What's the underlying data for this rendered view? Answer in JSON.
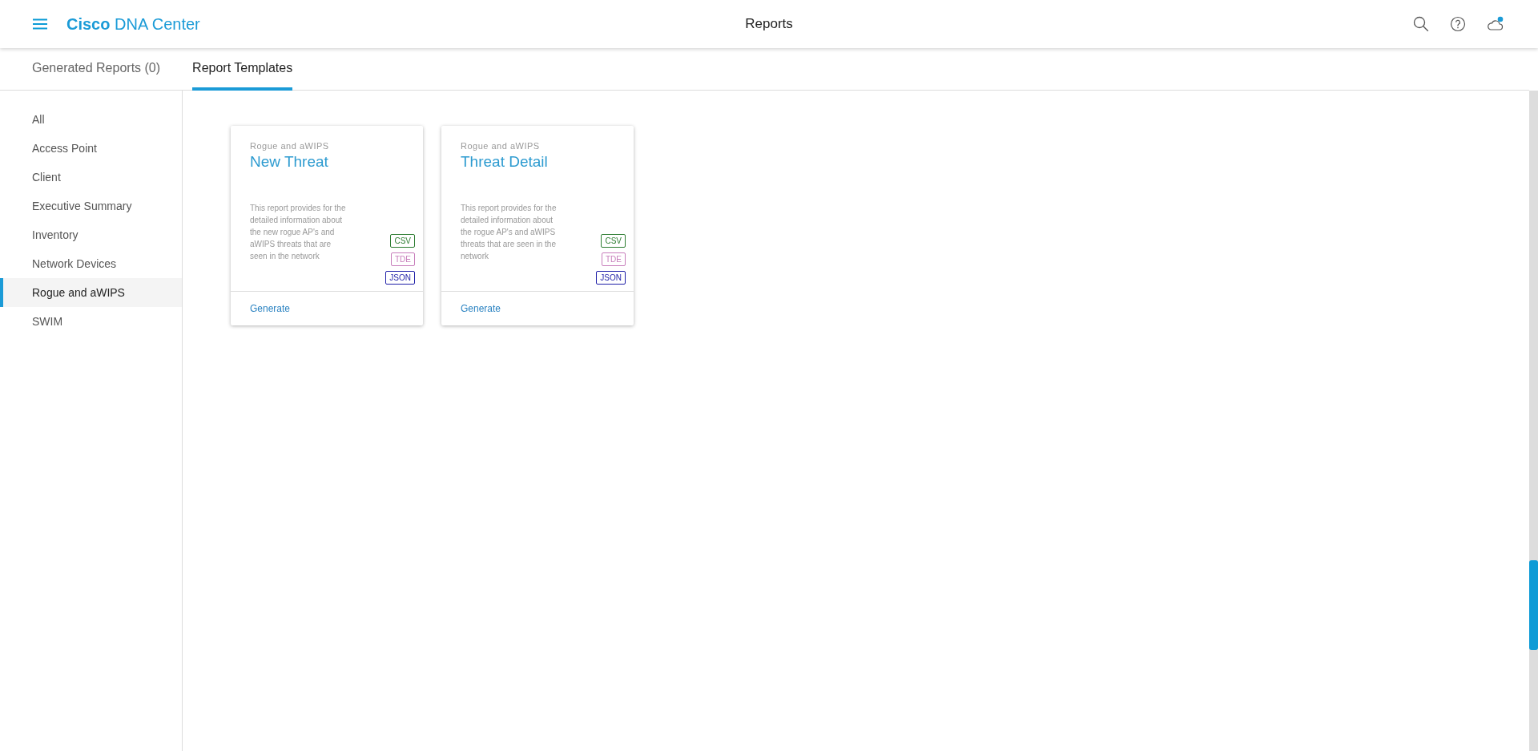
{
  "header": {
    "brand_bold": "Cisco",
    "brand_rest": "DNA Center",
    "title": "Reports",
    "notification": true
  },
  "tabs": [
    {
      "label": "Generated Reports (0)",
      "selected": false
    },
    {
      "label": "Report Templates",
      "selected": true
    }
  ],
  "sidebar": {
    "items": [
      {
        "label": "All",
        "selected": false
      },
      {
        "label": "Access Point",
        "selected": false
      },
      {
        "label": "Client",
        "selected": false
      },
      {
        "label": "Executive Summary",
        "selected": false
      },
      {
        "label": "Inventory",
        "selected": false
      },
      {
        "label": "Network Devices",
        "selected": false
      },
      {
        "label": "Rogue and aWIPS",
        "selected": true
      },
      {
        "label": "SWIM",
        "selected": false
      }
    ]
  },
  "cards": [
    {
      "category": "Rogue and aWIPS",
      "title": "New Threat",
      "description": "This report provides for the detailed information about the new rogue AP's and aWIPS threats that are seen in the network",
      "formats": [
        {
          "label": "CSV",
          "color": "#2e7d32"
        },
        {
          "label": "TDE",
          "color": "#c77dbb"
        },
        {
          "label": "JSON",
          "color": "#1f1fa8"
        }
      ],
      "action": "Generate"
    },
    {
      "category": "Rogue and aWIPS",
      "title": "Threat Detail",
      "description": "This report provides for the detailed information about the rogue AP's and aWIPS threats that are seen in the network",
      "formats": [
        {
          "label": "CSV",
          "color": "#2e7d32"
        },
        {
          "label": "TDE",
          "color": "#c77dbb"
        },
        {
          "label": "JSON",
          "color": "#1f1fa8"
        }
      ],
      "action": "Generate"
    }
  ]
}
